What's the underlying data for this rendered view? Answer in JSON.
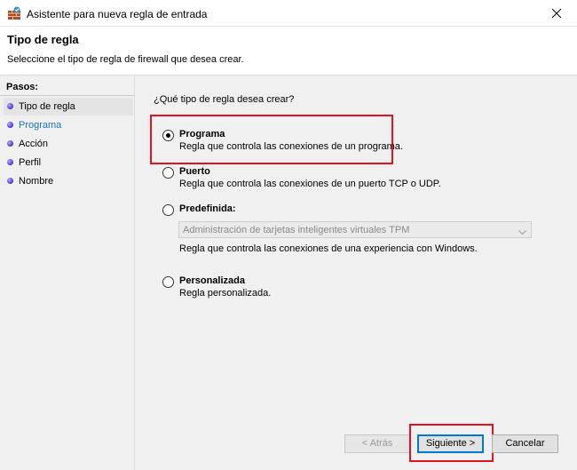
{
  "window": {
    "title": "Asistente para nueva regla de entrada",
    "close_glyph": "✕"
  },
  "header": {
    "title": "Tipo de regla",
    "subtitle": "Seleccione el tipo de regla de firewall que desea crear."
  },
  "steps": {
    "title": "Pasos:",
    "items": [
      {
        "label": "Tipo de regla"
      },
      {
        "label": "Programa"
      },
      {
        "label": "Acción"
      },
      {
        "label": "Perfil"
      },
      {
        "label": "Nombre"
      }
    ]
  },
  "content": {
    "question": "¿Qué tipo de regla desea crear?",
    "options": [
      {
        "title": "Programa",
        "description": "Regla que controla las conexiones de un programa.",
        "checked": true
      },
      {
        "title": "Puerto",
        "description": "Regla que controla las conexiones de un puerto TCP o UDP.",
        "checked": false
      },
      {
        "title": "Predefinida:",
        "description": "Regla que controla las conexiones de una experiencia con Windows.",
        "checked": false
      },
      {
        "title": "Personalizada",
        "description": "Regla personalizada.",
        "checked": false
      }
    ],
    "predefined_select": {
      "value": "Administración de tarjetas inteligentes virtuales TPM"
    }
  },
  "buttons": {
    "back": "< Atrás",
    "next": "Siguiente >",
    "cancel": "Cancelar"
  },
  "colors": {
    "highlight": "#e3131b",
    "current_step": "#1e6fc8",
    "focus_border": "#0078d7"
  }
}
